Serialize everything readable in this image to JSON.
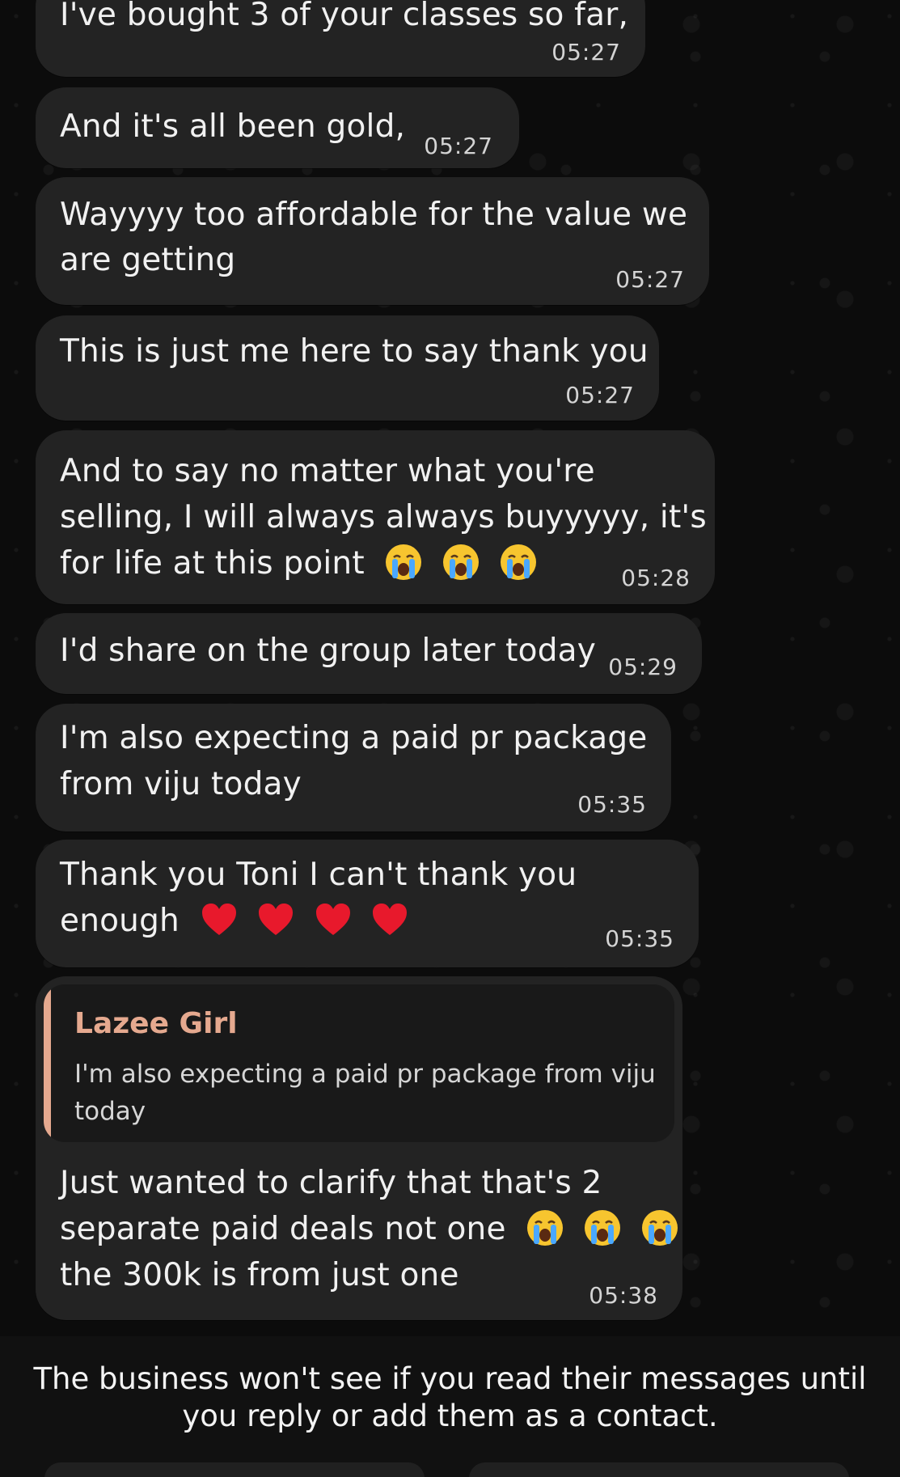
{
  "chat": {
    "messages": [
      {
        "id": "m0",
        "lines": [
          "I've bought 3 of your classes so far,"
        ],
        "time": "05:27"
      },
      {
        "id": "m1",
        "lines": [
          "And it's all been gold,"
        ],
        "time": "05:27"
      },
      {
        "id": "m2",
        "lines": [
          "Wayyyy too affordable for the value we",
          "are getting"
        ],
        "time": "05:27"
      },
      {
        "id": "m3",
        "lines": [
          "This is just me here to say thank you"
        ],
        "time": "05:27"
      },
      {
        "id": "m4",
        "lines": [
          "And to say no matter what you're",
          "selling, I will always always buyyyyy, it's",
          "for life at this point"
        ],
        "emoji": [
          "loudly-crying-face",
          "loudly-crying-face",
          "loudly-crying-face"
        ],
        "time": "05:28"
      },
      {
        "id": "m5",
        "lines": [
          "I'd share on the group later today"
        ],
        "time": "05:29"
      },
      {
        "id": "m6",
        "lines": [
          "I'm also expecting a paid pr package",
          "from viju today"
        ],
        "time": "05:35"
      },
      {
        "id": "m7",
        "lines": [
          "Thank you Toni I can't thank you",
          "enough"
        ],
        "emoji": [
          "red-heart",
          "red-heart",
          "red-heart",
          "red-heart"
        ],
        "time": "05:35"
      },
      {
        "id": "m8",
        "quote": {
          "author": "Lazee Girl",
          "text": "I'm also expecting a paid pr package from viju today"
        },
        "lines": [
          "Just wanted to clarify that that's 2",
          "separate paid deals not one",
          "the 300k is from just one"
        ],
        "emoji": [
          "loudly-crying-face",
          "loudly-crying-face",
          "loudly-crying-face"
        ],
        "time": "05:38"
      }
    ]
  },
  "notice": {
    "line1": "The business won't see if you read their messages until",
    "line2": "you reply or add them as a contact."
  },
  "colors": {
    "background": "#0c0c0c",
    "bubble": "#232323",
    "quote_accent": "#e5a98f",
    "text": "#f1f1f1"
  }
}
